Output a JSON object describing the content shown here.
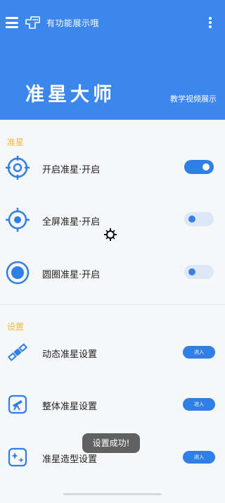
{
  "header": {
    "subtitle": "有功能展示哦",
    "title": "准星大师",
    "video_link": "教学视频展示"
  },
  "sections": {
    "crosshair": {
      "title": "准星",
      "items": [
        {
          "label": "开启准星·开启",
          "toggle": "on"
        },
        {
          "label": "全屏准星·开启",
          "toggle": "off"
        },
        {
          "label": "圆圈准星·开启",
          "toggle": "off"
        }
      ]
    },
    "settings": {
      "title": "设置",
      "items": [
        {
          "label": "动态准星设置",
          "button": "进入"
        },
        {
          "label": "整体准星设置",
          "button": "进入"
        },
        {
          "label": "准星造型设置",
          "button": "进入"
        }
      ]
    }
  },
  "toast": "设置成功!",
  "colors": {
    "header_bg": "#3b87ee",
    "accent": "#2f7fe6",
    "section_title": "#f0b840"
  }
}
